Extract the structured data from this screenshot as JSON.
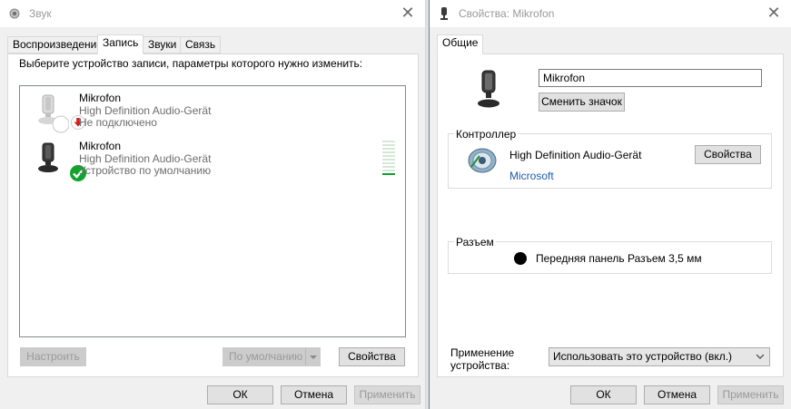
{
  "left_window": {
    "title": "Звук",
    "tabs": [
      "Воспроизведение",
      "Запись",
      "Звуки",
      "Связь"
    ],
    "instruction": "Выберите устройство записи, параметры которого нужно изменить:",
    "devices": [
      {
        "name": "Mikrofon",
        "driver": "High Definition Audio-Gerät",
        "status": "Не подключено",
        "status_icon": "red-down-arrow-icon"
      },
      {
        "name": "Mikrofon",
        "driver": "High Definition Audio-Gerät",
        "status": "Устройство по умолчанию",
        "status_icon": "green-check-icon"
      }
    ],
    "level_meter": {
      "segments": 10,
      "active": 1
    },
    "buttons": {
      "configure": "Настроить",
      "default": "По умолчанию",
      "properties": "Свойства",
      "ok": "ОК",
      "cancel": "Отмена",
      "apply": "Применить"
    }
  },
  "right_window": {
    "title": "Свойства: Mikrofon",
    "tab": "Общие",
    "device_name": "Mikrofon",
    "change_icon": "Сменить значок",
    "controller": {
      "label": "Контроллер",
      "name": "High Definition Audio-Gerät",
      "vendor": "Microsoft",
      "properties": "Свойства"
    },
    "jack": {
      "label": "Разъем",
      "description": "Передняя панель Разъем 3,5 мм",
      "color": "#000000"
    },
    "usage": {
      "label_line1": "Применение",
      "label_line2": "устройства:",
      "value": "Использовать это устройство (вкл.)"
    },
    "buttons": {
      "ok": "ОК",
      "cancel": "Отмена",
      "apply": "Применить"
    }
  },
  "colors": {
    "accent_blue": "#1c5dad",
    "green_level": "#0f9d2e",
    "disabled_text": "#9a9a9a"
  }
}
